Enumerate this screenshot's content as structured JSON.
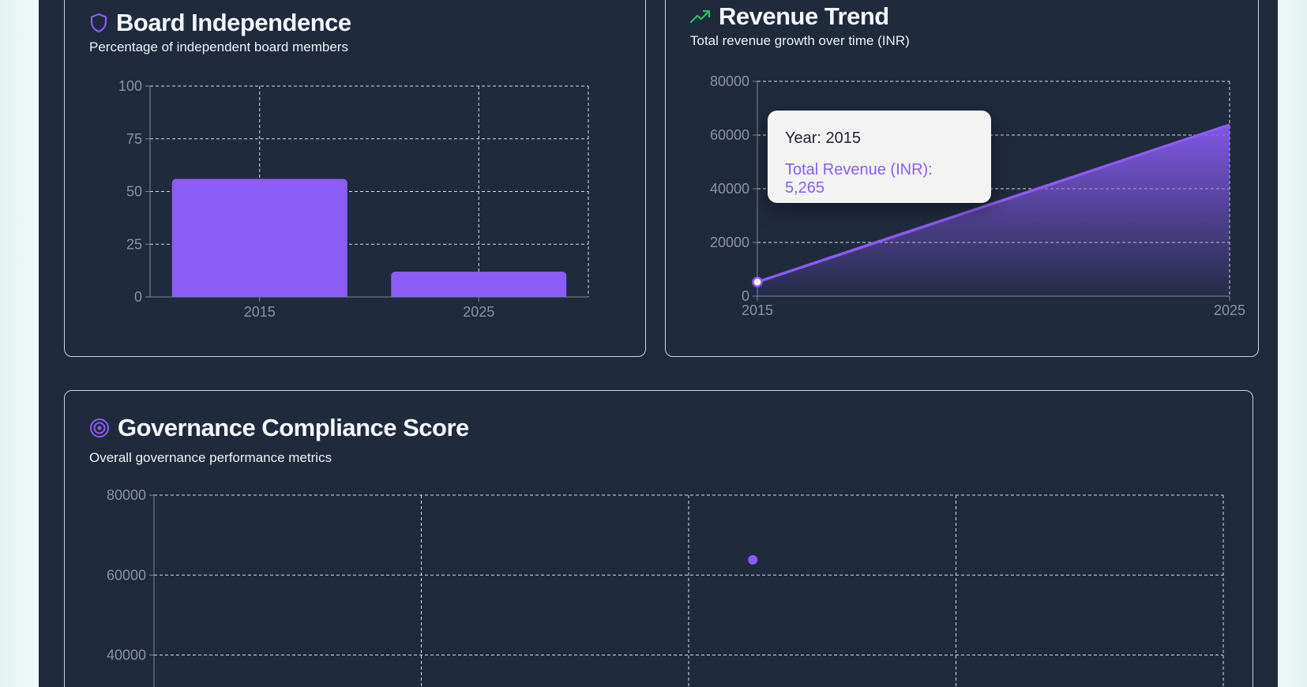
{
  "colors": {
    "background": "#eefaf8",
    "panel": "#1f2a3d",
    "accent": "#8b5cf6",
    "trend_icon": "#22c55e",
    "shield_icon": "#8b5cf6",
    "target_icon": "#8b5cf6"
  },
  "board_card": {
    "icon": "shield-icon",
    "title": "Board Independence",
    "subtitle": "Percentage of independent board members"
  },
  "revenue_card": {
    "icon": "trending-up-icon",
    "title": "Revenue Trend",
    "subtitle": "Total revenue growth over time (INR)",
    "tooltip": {
      "label": "Year: 2015",
      "value": "Total Revenue (INR): 5,265"
    }
  },
  "governance_card": {
    "icon": "target-icon",
    "title": "Governance Compliance Score",
    "subtitle": "Overall governance performance metrics"
  },
  "chart_data": [
    {
      "type": "bar",
      "categories": [
        "2015",
        "2025"
      ],
      "values": [
        56,
        12
      ],
      "ylim": [
        0,
        100
      ],
      "yticks": [
        0,
        25,
        50,
        75,
        100
      ],
      "grid": true
    },
    {
      "type": "area",
      "x": [
        "2015",
        "2025"
      ],
      "series": [
        {
          "name": "Total Revenue (INR)",
          "values": [
            5265,
            63800
          ]
        }
      ],
      "ylim": [
        0,
        80000
      ],
      "yticks": [
        0,
        20000,
        40000,
        60000,
        80000
      ],
      "grid": true
    },
    {
      "type": "scatter",
      "points": [
        {
          "x": 2.24,
          "y": 63800
        }
      ],
      "xlim": [
        0,
        4
      ],
      "ylim": [
        0,
        80000
      ],
      "yticks_visible": [
        40000,
        60000,
        80000
      ],
      "grid": true
    }
  ]
}
